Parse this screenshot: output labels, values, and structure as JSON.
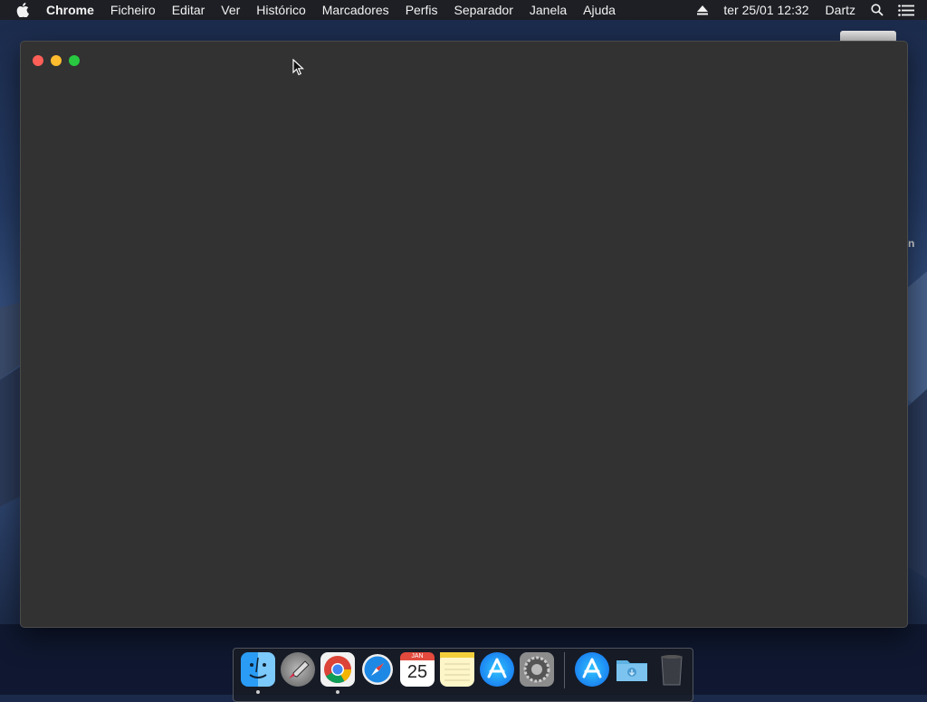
{
  "menubar": {
    "apple": "apple-icon",
    "app_name": "Chrome",
    "items": [
      "Ficheiro",
      "Editar",
      "Ver",
      "Histórico",
      "Marcadores",
      "Perfis",
      "Separador",
      "Janela",
      "Ajuda"
    ],
    "datetime": "ter 25/01  12:32",
    "user": "Dartz"
  },
  "desktop": {
    "label_fragment": "n"
  },
  "window": {
    "buttons": [
      "close",
      "minimize",
      "maximize"
    ]
  },
  "dock": {
    "apps": [
      {
        "name": "Finder",
        "icon": "finder-icon",
        "running": true
      },
      {
        "name": "Launchpad",
        "icon": "launchpad-icon",
        "running": false
      },
      {
        "name": "Chrome",
        "icon": "chrome-icon",
        "running": true
      },
      {
        "name": "Safari",
        "icon": "safari-icon",
        "running": false
      },
      {
        "name": "Calendar",
        "icon": "calendar-icon",
        "running": false,
        "month": "JAN",
        "day": "25"
      },
      {
        "name": "Notes",
        "icon": "notes-icon",
        "running": false
      },
      {
        "name": "App Store",
        "icon": "app-store-icon",
        "running": false
      },
      {
        "name": "System Preferences",
        "icon": "system-preferences-icon",
        "running": false
      },
      {
        "name": "App Store Download",
        "icon": "app-store-download-icon",
        "running": false
      },
      {
        "name": "Downloads",
        "icon": "downloads-folder-icon",
        "running": false
      },
      {
        "name": "Trash",
        "icon": "trash-icon",
        "running": false
      }
    ]
  }
}
